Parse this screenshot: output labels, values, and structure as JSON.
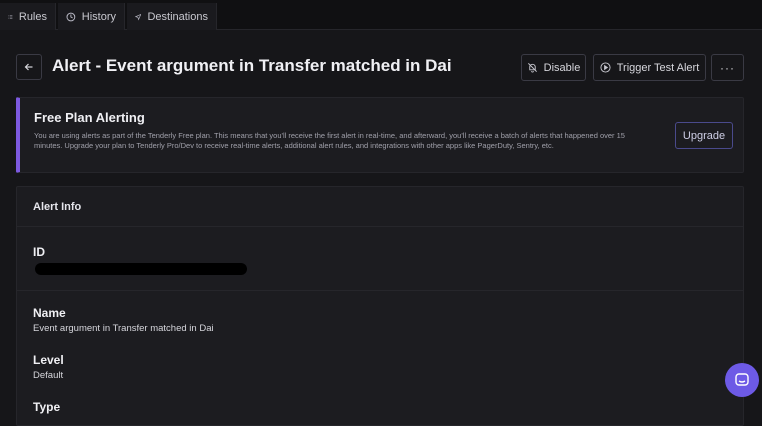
{
  "tabs": [
    {
      "label": "Rules",
      "icon": "list-icon"
    },
    {
      "label": "History",
      "icon": "clock-icon"
    },
    {
      "label": "Destinations",
      "icon": "send-icon"
    }
  ],
  "header": {
    "title": "Alert - Event argument in Transfer matched in Dai",
    "back_icon": "arrow-left-icon",
    "disable_label": "Disable",
    "trigger_label": "Trigger Test Alert",
    "more_label": "···"
  },
  "banner": {
    "title": "Free Plan Alerting",
    "text": "You are using alerts as part of the Tenderly Free plan. This means that you'll receive the first alert in real-time, and afterward, you'll receive a batch of alerts that happened over 15 minutes. Upgrade your plan to Tenderly Pro/Dev to receive real-time alerts, additional alert rules, and integrations with other apps like PagerDuty, Sentry, etc.",
    "upgrade_label": "Upgrade"
  },
  "alert_info": {
    "title": "Alert Info",
    "id_label": "ID",
    "name_label": "Name",
    "name_value": "Event argument in Transfer matched in Dai",
    "level_label": "Level",
    "level_value": "Default",
    "type_label": "Type"
  },
  "colors": {
    "accent": "#7d5ae0",
    "background": "#161619",
    "card": "#1c1c20",
    "chat": "#6d5ae6"
  }
}
